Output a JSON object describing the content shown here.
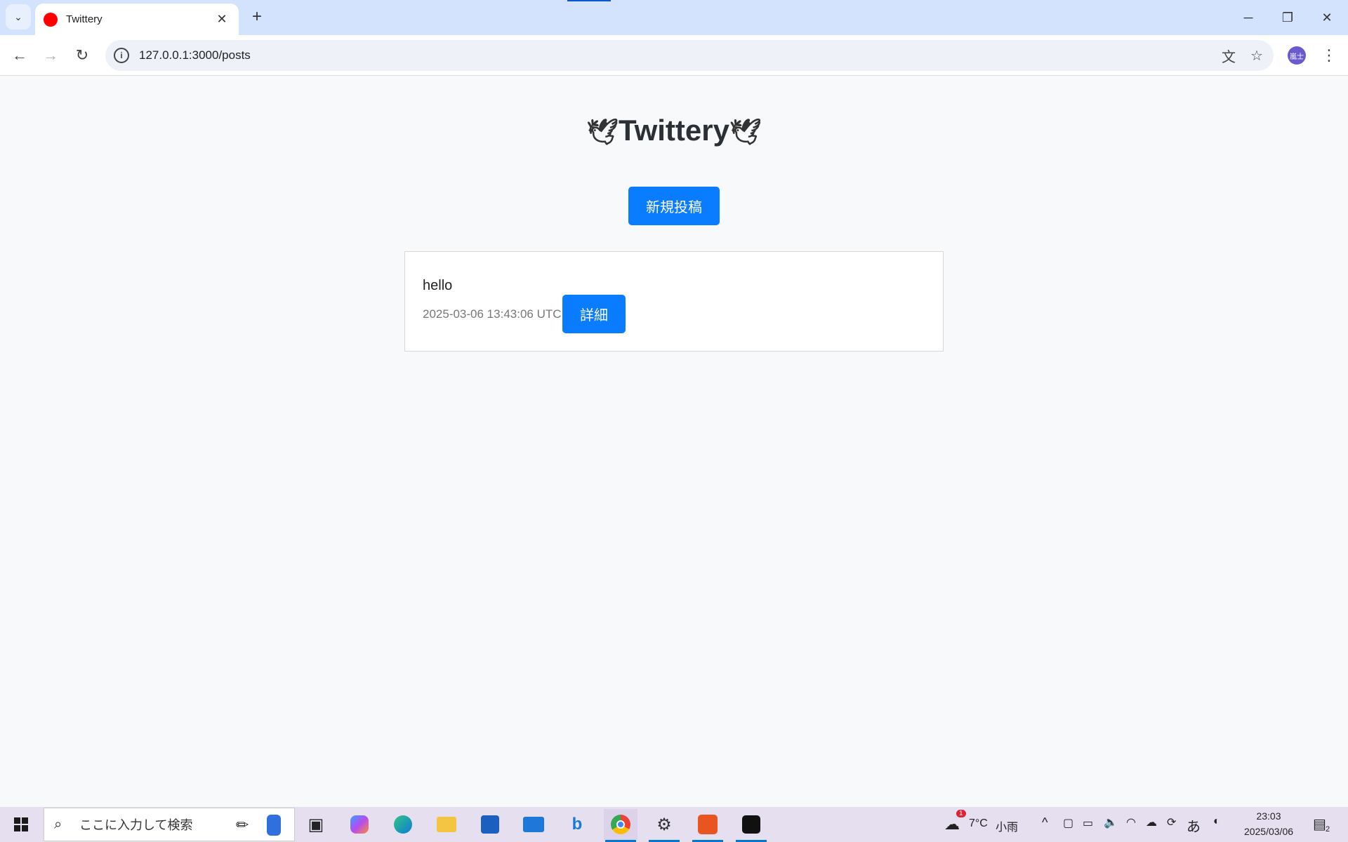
{
  "browser": {
    "tab_title": "Twittery",
    "url": "127.0.0.1:3000/posts",
    "profile_initials": "嵐士",
    "favicon_color": "#ff0000"
  },
  "page": {
    "title": "Twittery",
    "title_icon": "🕊",
    "new_post_label": "新規投稿",
    "posts": [
      {
        "content": "hello",
        "timestamp": "2025-03-06 13:43:06 UTC",
        "detail_label": "詳細"
      }
    ],
    "accent_color": "#0a7cff"
  },
  "taskbar": {
    "search_placeholder": "ここに入力して検索",
    "weather_temp": "7°C",
    "weather_text": "小雨",
    "weather_badge": "1",
    "ime": "あ",
    "time": "23:03",
    "date": "2025/03/06",
    "notification_count": "2"
  }
}
